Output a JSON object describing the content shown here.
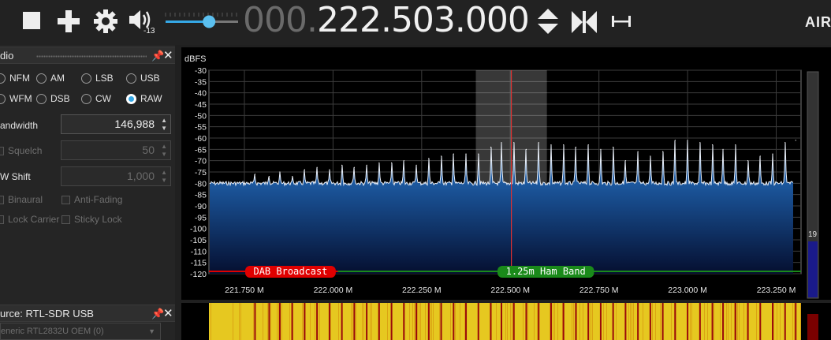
{
  "toolbar": {
    "stop_icon": "stop-icon",
    "add_icon": "plus-icon",
    "settings_icon": "gear-icon",
    "volume_icon": "speaker-icon",
    "volume_value": "-13",
    "volume_level": 0.6,
    "frequency_dim": "000.",
    "frequency_bright": "222.503.000",
    "logo": "AIR"
  },
  "radio_panel": {
    "title": "dio",
    "modes": [
      {
        "label": "NFM",
        "selected": false
      },
      {
        "label": "AM",
        "selected": false
      },
      {
        "label": "LSB",
        "selected": false
      },
      {
        "label": "USB",
        "selected": false
      },
      {
        "label": "WFM",
        "selected": false
      },
      {
        "label": "DSB",
        "selected": false
      },
      {
        "label": "CW",
        "selected": false
      },
      {
        "label": "RAW",
        "selected": true
      }
    ],
    "bandwidth_label": "andwidth",
    "bandwidth_value": "146,988",
    "squelch_label": "Squelch",
    "squelch_value": "50",
    "shift_label": "W Shift",
    "shift_value": "1,000",
    "binaural_label": "Binaural",
    "antifading_label": "Anti-Fading",
    "lockcarrier_label": "Lock Carrier",
    "stickylock_label": "Sticky Lock"
  },
  "source_panel": {
    "title": "urce: RTL-SDR USB",
    "device": "eneric RTL2832U OEM (0)"
  },
  "chart_data": {
    "type": "line",
    "ylabel": "dBFS",
    "ylim": [
      -120,
      -30
    ],
    "yticks": [
      "-30",
      "-35",
      "-40",
      "-45",
      "-50",
      "-55",
      "-60",
      "-65",
      "-70",
      "-75",
      "-80",
      "-85",
      "-90",
      "-95",
      "-100",
      "-105",
      "-110",
      "-115",
      "-120"
    ],
    "xlim": [
      221.65,
      223.32
    ],
    "xticks": [
      "221.750 M",
      "222.000 M",
      "222.250 M",
      "222.500 M",
      "222.750 M",
      "223.000 M",
      "223.250 M"
    ],
    "noise_floor_db": -80,
    "tuned_frequency_mhz": 222.503,
    "filter_bandwidth_mhz": 0.147,
    "peaks": [
      {
        "f": 221.78,
        "db": -76
      },
      {
        "f": 221.82,
        "db": -77
      },
      {
        "f": 221.85,
        "db": -75
      },
      {
        "f": 221.885,
        "db": -77
      },
      {
        "f": 221.92,
        "db": -74
      },
      {
        "f": 221.955,
        "db": -73
      },
      {
        "f": 221.99,
        "db": -74
      },
      {
        "f": 222.025,
        "db": -72
      },
      {
        "f": 222.06,
        "db": -73
      },
      {
        "f": 222.095,
        "db": -72
      },
      {
        "f": 222.13,
        "db": -71
      },
      {
        "f": 222.165,
        "db": -71
      },
      {
        "f": 222.2,
        "db": -70
      },
      {
        "f": 222.235,
        "db": -72
      },
      {
        "f": 222.27,
        "db": -69
      },
      {
        "f": 222.305,
        "db": -68
      },
      {
        "f": 222.34,
        "db": -67
      },
      {
        "f": 222.375,
        "db": -67
      },
      {
        "f": 222.41,
        "db": -67
      },
      {
        "f": 222.445,
        "db": -64
      },
      {
        "f": 222.475,
        "db": -62
      },
      {
        "f": 222.51,
        "db": -62
      },
      {
        "f": 222.545,
        "db": -65
      },
      {
        "f": 222.58,
        "db": -62
      },
      {
        "f": 222.615,
        "db": -63
      },
      {
        "f": 222.65,
        "db": -63
      },
      {
        "f": 222.685,
        "db": -64
      },
      {
        "f": 222.72,
        "db": -63
      },
      {
        "f": 222.755,
        "db": -65
      },
      {
        "f": 222.79,
        "db": -64
      },
      {
        "f": 222.825,
        "db": -70
      },
      {
        "f": 222.86,
        "db": -66
      },
      {
        "f": 222.895,
        "db": -68
      },
      {
        "f": 222.93,
        "db": -66
      },
      {
        "f": 222.965,
        "db": -61
      },
      {
        "f": 223.0,
        "db": -61
      },
      {
        "f": 223.035,
        "db": -62
      },
      {
        "f": 223.07,
        "db": -63
      },
      {
        "f": 223.1,
        "db": -65
      },
      {
        "f": 223.135,
        "db": -63
      },
      {
        "f": 223.17,
        "db": -70
      },
      {
        "f": 223.205,
        "db": -68
      },
      {
        "f": 223.24,
        "db": -67
      },
      {
        "f": 223.275,
        "db": -62
      },
      {
        "f": 223.305,
        "db": -61
      }
    ],
    "bands": [
      {
        "label": "DAB Broadcast",
        "color": "#e00000",
        "f": 221.88
      },
      {
        "label": "1.25m Ham Band",
        "color": "#1a8a1a",
        "f": 222.6
      }
    ],
    "side_meter_value": "19"
  },
  "colors": {
    "accent": "#35a8e6",
    "spectrum_fill": "#1f5fae",
    "tuned_line": "#e03030"
  }
}
